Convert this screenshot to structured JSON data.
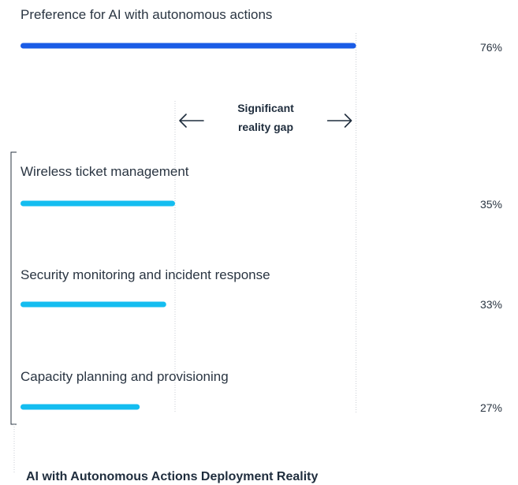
{
  "chart_data": {
    "type": "bar",
    "orientation": "horizontal",
    "unit": "%",
    "xlim": [
      0,
      100
    ],
    "items": [
      {
        "label": "Preference for AI with autonomous actions",
        "value": 76,
        "value_label": "76%",
        "color": "#1a5ce6"
      },
      {
        "label": "Wireless ticket management",
        "value": 35,
        "value_label": "35%",
        "color": "#14bdf0"
      },
      {
        "label": "Security monitoring and incident response",
        "value": 33,
        "value_label": "33%",
        "color": "#14bdf0"
      },
      {
        "label": "Capacity planning and provisioning",
        "value": 27,
        "value_label": "27%",
        "color": "#14bdf0"
      }
    ],
    "annotation": {
      "line1": "Significant",
      "line2": "reality gap",
      "left_arrow": "arrow-left-icon",
      "right_arrow": "arrow-right-icon"
    },
    "group_title": "AI with Autonomous Actions Deployment Reality"
  }
}
